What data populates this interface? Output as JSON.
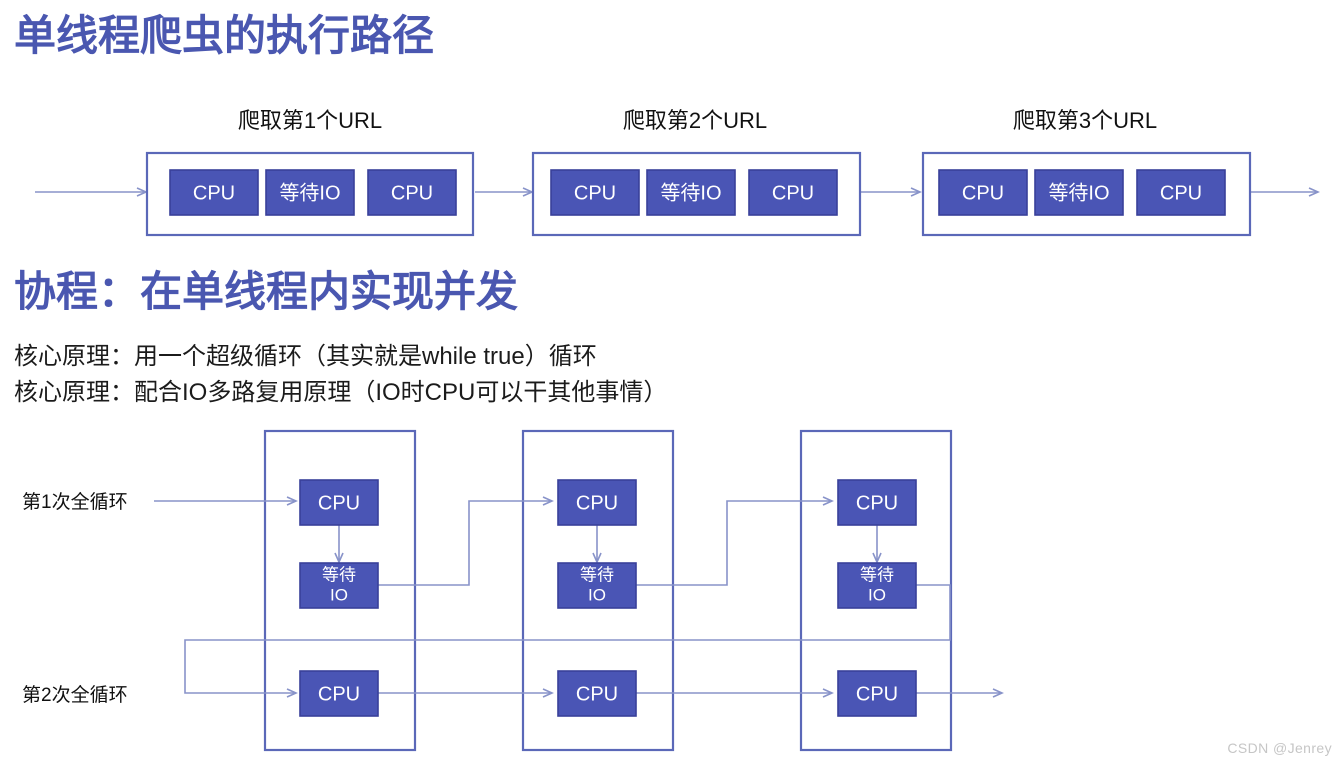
{
  "slide": {
    "title_main": "单线程爬虫的执行路径",
    "title_sub": "协程：在单线程内实现并发",
    "principle_line_1": "核心原理：用一个超级循环（其实就是while true）循环",
    "principle_line_2": "核心原理：配合IO多路复用原理（IO时CPU可以干其他事情）",
    "watermark": "CSDN @Jenrey"
  },
  "colors": {
    "title": "#4a57b0",
    "box_fill": "#4a55b5",
    "box_stroke": "#39409a",
    "container_stroke": "#5b68b8",
    "connector": "#8893c9",
    "text_dark": "#1b1b1b",
    "box_text": "#ffffff",
    "background": "#ffffff"
  },
  "single_thread": {
    "groups": [
      {
        "label": "爬取第1个URL",
        "steps": [
          "CPU",
          "等待IO",
          "CPU"
        ]
      },
      {
        "label": "爬取第2个URL",
        "steps": [
          "CPU",
          "等待IO",
          "CPU"
        ]
      },
      {
        "label": "爬取第3个URL",
        "steps": [
          "CPU",
          "等待IO",
          "CPU"
        ]
      }
    ]
  },
  "coroutine": {
    "row_labels": [
      "第1次全循环",
      "第2次全循环"
    ],
    "columns": [
      {
        "round1": [
          "CPU",
          "等待\nIO"
        ],
        "round2": [
          "CPU"
        ]
      },
      {
        "round1": [
          "CPU",
          "等待\nIO"
        ],
        "round2": [
          "CPU"
        ]
      },
      {
        "round1": [
          "CPU",
          "等待\nIO"
        ],
        "round2": [
          "CPU"
        ]
      }
    ],
    "box_labels": {
      "cpu": "CPU",
      "wait_top": "等待",
      "wait_bottom": "IO"
    }
  }
}
